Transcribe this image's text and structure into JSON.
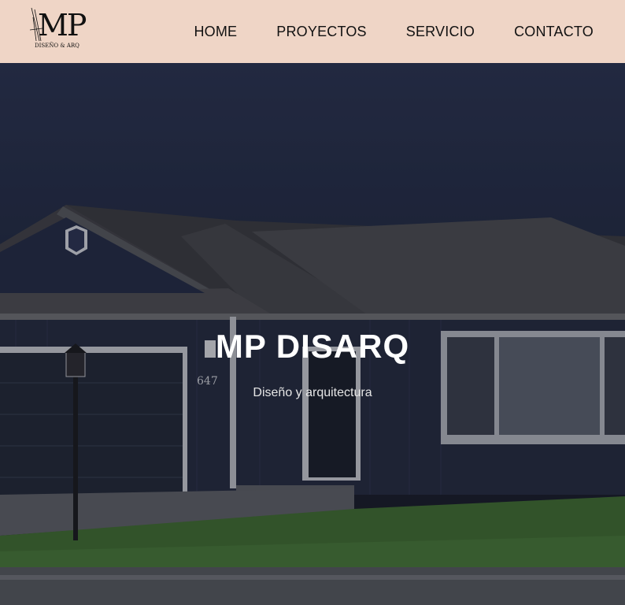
{
  "header": {
    "logo": {
      "monogram": "MP",
      "subtitle": "DISEÑO & ARQ"
    },
    "nav": [
      {
        "label": "HOME"
      },
      {
        "label": "PROYECTOS"
      },
      {
        "label": "SERVICIO"
      },
      {
        "label": "CONTACTO"
      }
    ]
  },
  "hero": {
    "title": "MP DISARQ",
    "subtitle": "Diseño y arquitectura",
    "house_number": "647"
  },
  "colors": {
    "navbar_bg": "#efd5c6",
    "nav_text": "#111111",
    "hero_text": "#ffffff"
  }
}
